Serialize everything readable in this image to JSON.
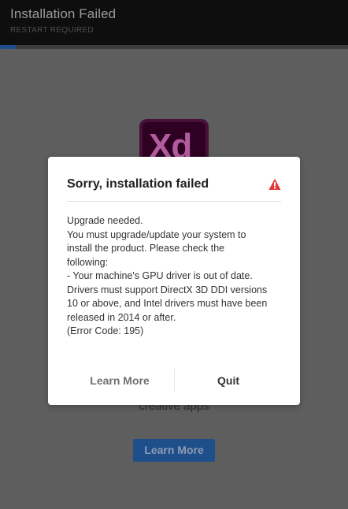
{
  "window": {
    "title": "Installation Failed",
    "subtitle": "RESTART REQUIRED",
    "progress": 0.045
  },
  "background": {
    "app_icon_text": "Xd",
    "caption": "creative apps",
    "learn_more_label": "Learn More"
  },
  "dialog": {
    "heading": "Sorry, installation failed",
    "warning_icon": "warning-triangle-icon",
    "warning_color": "#e03b3b",
    "body_lines": [
      "Upgrade needed.",
      "You must upgrade/update your system to",
      "install the product. Please check the",
      "following:",
      "- Your machine's GPU driver is out of date.",
      "Drivers must support DirectX 3D DDI versions",
      "10 or above, and Intel drivers must have been",
      "released in 2014 or after.",
      "(Error Code: 195)"
    ],
    "learn_more_label": "Learn More",
    "quit_label": "Quit"
  }
}
